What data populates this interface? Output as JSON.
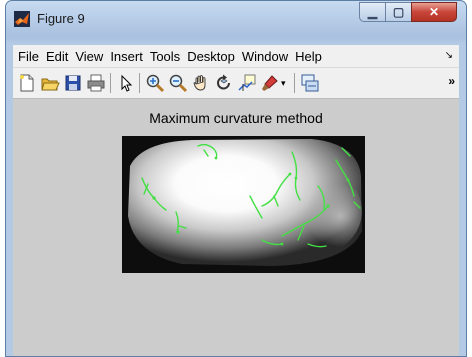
{
  "window": {
    "title": "Figure 9",
    "controls": [
      "minimize",
      "maximize",
      "close"
    ]
  },
  "menubar": {
    "items": [
      "File",
      "Edit",
      "View",
      "Insert",
      "Tools",
      "Desktop",
      "Window",
      "Help"
    ]
  },
  "toolbar": {
    "buttons": [
      {
        "name": "new-figure-icon"
      },
      {
        "name": "open-file-icon"
      },
      {
        "name": "save-figure-icon"
      },
      {
        "name": "print-figure-icon"
      },
      {
        "name": "edit-plot-arrow-icon"
      },
      {
        "name": "zoom-in-icon"
      },
      {
        "name": "zoom-out-icon"
      },
      {
        "name": "pan-hand-icon"
      },
      {
        "name": "rotate-3d-icon"
      },
      {
        "name": "data-cursor-icon"
      },
      {
        "name": "brush-icon"
      },
      {
        "name": "brush-dropdown-icon"
      },
      {
        "name": "link-plot-icon"
      }
    ],
    "overflow": "»"
  },
  "figure": {
    "plot_title": "Maximum curvature method",
    "image": {
      "description_icon": "grayscale-image-with-green-vein-overlay",
      "colors": {
        "vein": "#43e043",
        "background": "#0d0d0d"
      }
    }
  },
  "colors": {
    "window_frame": "#b3c9e4",
    "figure_bg": "#cccccc",
    "menubar_bg": "#f0f0f0",
    "close_button": "#c8453a"
  }
}
